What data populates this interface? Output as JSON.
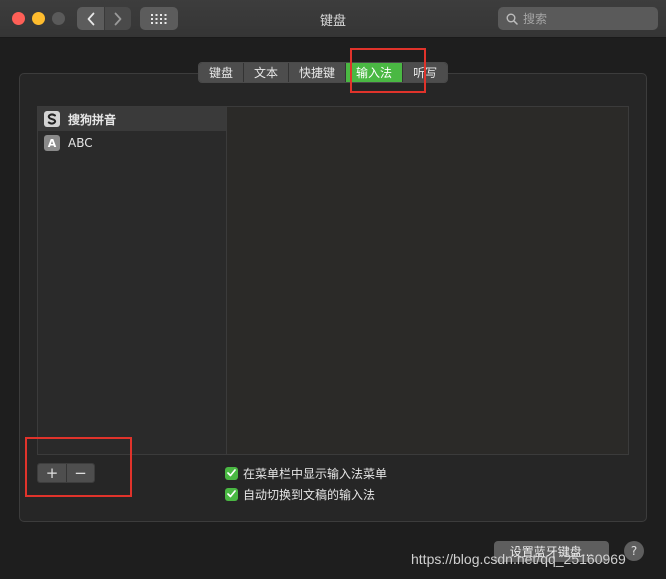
{
  "window": {
    "title": "键盘",
    "search_placeholder": "搜索"
  },
  "tabs": [
    {
      "label": "键盘",
      "active": false
    },
    {
      "label": "文本",
      "active": false
    },
    {
      "label": "快捷键",
      "active": false
    },
    {
      "label": "输入法",
      "active": true
    },
    {
      "label": "听写",
      "active": false
    }
  ],
  "input_sources": [
    {
      "label": "搜狗拼音",
      "icon": "sogou-icon",
      "selected": true
    },
    {
      "label": "ABC",
      "icon": "abc-icon",
      "icon_text": "A",
      "selected": false
    }
  ],
  "list_controls": {
    "add": "+",
    "remove": "−"
  },
  "options": [
    {
      "label": "在菜单栏中显示输入法菜单",
      "checked": true
    },
    {
      "label": "自动切换到文稿的输入法",
      "checked": true
    }
  ],
  "footer": {
    "bluetooth_button": "设置蓝牙键盘...",
    "help": "?",
    "watermark": "https://blog.csdn.net/qq_25160969"
  },
  "colors": {
    "accent_green": "#4ab843",
    "annotation_red": "#e0332b",
    "close": "#fe5f57",
    "minimize": "#febc2e"
  }
}
